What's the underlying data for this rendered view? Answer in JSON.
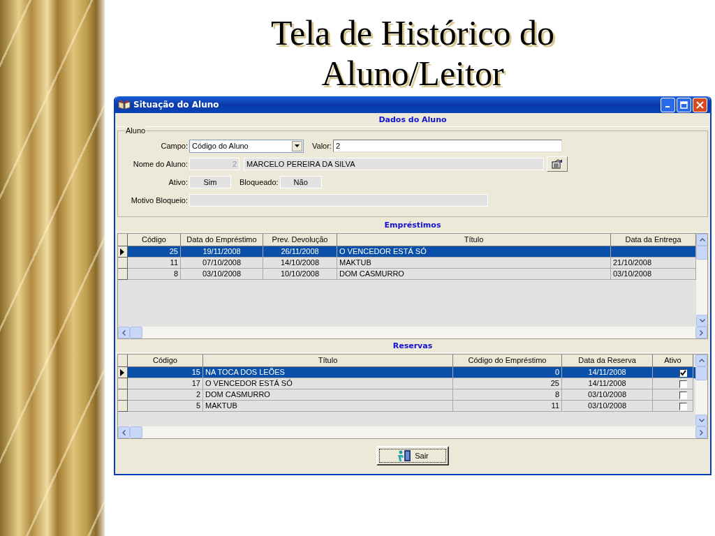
{
  "slide_title": "Tela de Histórico do Aluno/Leitor",
  "window": {
    "title": "Situação do Aluno"
  },
  "student_section": {
    "title": "Dados do Aluno",
    "group_label": "Aluno",
    "campo": {
      "label": "Campo:",
      "value": "Código do Aluno"
    },
    "valor": {
      "label": "Valor:",
      "value": "2"
    },
    "nome": {
      "label": "Nome do Aluno:",
      "code": "2",
      "name": "MARCELO PEREIRA DA SILVA"
    },
    "ativo": {
      "label": "Ativo:",
      "value": "Sim"
    },
    "bloqueado": {
      "label": "Bloqueado:",
      "value": "Não"
    },
    "motivo": {
      "label": "Motivo Bloqueio:"
    }
  },
  "loans": {
    "title": "Empréstimos",
    "columns": [
      "Código",
      "Data do Empréstimo",
      "Prev. Devolução",
      "Título",
      "Data da Entrega"
    ],
    "rows": [
      {
        "selected": true,
        "cells": [
          "25",
          "19/11/2008",
          "26/11/2008",
          "O VENCEDOR ESTÁ SÓ",
          ""
        ]
      },
      {
        "selected": false,
        "cells": [
          "11",
          "07/10/2008",
          "14/10/2008",
          "MAKTUB",
          "21/10/2008"
        ]
      },
      {
        "selected": false,
        "cells": [
          "8",
          "03/10/2008",
          "10/10/2008",
          "DOM CASMURRO",
          "03/10/2008"
        ]
      }
    ]
  },
  "reservations": {
    "title": "Reservas",
    "columns": [
      "Código",
      "Título",
      "Código do Empréstimo",
      "Data da Reserva",
      "Ativo"
    ],
    "rows": [
      {
        "selected": true,
        "checked": true,
        "cells": [
          "15",
          "NA TOCA DOS LEÕES",
          "0",
          "14/11/2008"
        ]
      },
      {
        "selected": false,
        "checked": false,
        "cells": [
          "17",
          "O VENCEDOR ESTÁ SÓ",
          "25",
          "14/11/2008"
        ]
      },
      {
        "selected": false,
        "checked": false,
        "cells": [
          "2",
          "DOM CASMURRO",
          "8",
          "03/10/2008"
        ]
      },
      {
        "selected": false,
        "checked": false,
        "cells": [
          "5",
          "MAKTUB",
          "11",
          "03/10/2008"
        ]
      }
    ]
  },
  "exit_button": {
    "label": "Sair"
  }
}
